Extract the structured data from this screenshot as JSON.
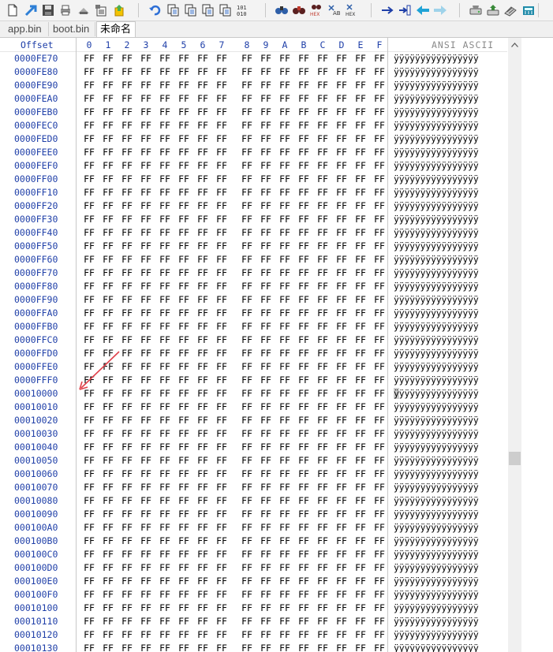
{
  "toolbar": {
    "buttons": [
      {
        "name": "new-file-icon",
        "color": "#3a6fc4"
      },
      {
        "name": "open-file-icon",
        "color": "#2e7fd6"
      },
      {
        "name": "save-icon",
        "color": "#4a4a4a"
      },
      {
        "name": "print-icon",
        "color": "#555555"
      },
      {
        "name": "print-preview-icon",
        "color": "#555555"
      },
      {
        "name": "properties-icon",
        "color": "#555555"
      },
      {
        "name": "export-icon",
        "color": "#d8a200"
      },
      {
        "name": "undo-icon",
        "color": "#2e6fd6"
      },
      {
        "name": "copy-icon",
        "color": "#3a6fc4"
      },
      {
        "name": "copy-block-icon",
        "color": "#3a6fc4"
      },
      {
        "name": "paste-icon",
        "color": "#3a6fc4"
      },
      {
        "name": "paste-write-icon",
        "color": "#3a6fc4"
      },
      {
        "name": "binary-icon",
        "color": "#333333"
      },
      {
        "name": "find-icon",
        "color": "#2e5fa8"
      },
      {
        "name": "find-text-icon",
        "color": "#c0392b"
      },
      {
        "name": "find-hex-icon",
        "color": "#c0392b"
      },
      {
        "name": "replace-text-icon",
        "color": "#2e5fa8"
      },
      {
        "name": "replace-hex-icon",
        "color": "#2e5fa8"
      },
      {
        "name": "goto-offset-icon",
        "color": "#1f3fa8"
      },
      {
        "name": "goto-sector-icon",
        "color": "#1f3fa8"
      },
      {
        "name": "back-icon",
        "color": "#1fa3d6"
      },
      {
        "name": "forward-icon",
        "color": "#9fd3ea"
      },
      {
        "name": "open-disk-icon",
        "color": "#555555"
      },
      {
        "name": "disk-tools-icon",
        "color": "#3a8a3a"
      },
      {
        "name": "ram-editor-icon",
        "color": "#555555"
      },
      {
        "name": "calculator-icon",
        "color": "#1f8aa8"
      }
    ],
    "labels": {
      "hex": "HEX",
      "binary_top": "101",
      "binary_bottom": "010",
      "ab": "AB"
    }
  },
  "tabs": [
    {
      "label": "app.bin",
      "active": false
    },
    {
      "label": "boot.bin",
      "active": false
    },
    {
      "label": "未命名",
      "active": true
    }
  ],
  "header": {
    "offset_label": "Offset",
    "columns": [
      "0",
      "1",
      "2",
      "3",
      "4",
      "5",
      "6",
      "7",
      "8",
      "9",
      "A",
      "B",
      "C",
      "D",
      "E",
      "F"
    ],
    "ascii_label": "ANSI ASCII"
  },
  "rows": [
    {
      "offset": "0000FE70",
      "bytes": [
        "FF",
        "FF",
        "FF",
        "FF",
        "FF",
        "FF",
        "FF",
        "FF",
        "FF",
        "FF",
        "FF",
        "FF",
        "FF",
        "FF",
        "FF",
        "FF"
      ],
      "ascii": "ÿÿÿÿÿÿÿÿÿÿÿÿÿÿÿÿ"
    },
    {
      "offset": "0000FE80",
      "bytes": [
        "FF",
        "FF",
        "FF",
        "FF",
        "FF",
        "FF",
        "FF",
        "FF",
        "FF",
        "FF",
        "FF",
        "FF",
        "FF",
        "FF",
        "FF",
        "FF"
      ],
      "ascii": "ÿÿÿÿÿÿÿÿÿÿÿÿÿÿÿÿ"
    },
    {
      "offset": "0000FE90",
      "bytes": [
        "FF",
        "FF",
        "FF",
        "FF",
        "FF",
        "FF",
        "FF",
        "FF",
        "FF",
        "FF",
        "FF",
        "FF",
        "FF",
        "FF",
        "FF",
        "FF"
      ],
      "ascii": "ÿÿÿÿÿÿÿÿÿÿÿÿÿÿÿÿ"
    },
    {
      "offset": "0000FEA0",
      "bytes": [
        "FF",
        "FF",
        "FF",
        "FF",
        "FF",
        "FF",
        "FF",
        "FF",
        "FF",
        "FF",
        "FF",
        "FF",
        "FF",
        "FF",
        "FF",
        "FF"
      ],
      "ascii": "ÿÿÿÿÿÿÿÿÿÿÿÿÿÿÿÿ"
    },
    {
      "offset": "0000FEB0",
      "bytes": [
        "FF",
        "FF",
        "FF",
        "FF",
        "FF",
        "FF",
        "FF",
        "FF",
        "FF",
        "FF",
        "FF",
        "FF",
        "FF",
        "FF",
        "FF",
        "FF"
      ],
      "ascii": "ÿÿÿÿÿÿÿÿÿÿÿÿÿÿÿÿ"
    },
    {
      "offset": "0000FEC0",
      "bytes": [
        "FF",
        "FF",
        "FF",
        "FF",
        "FF",
        "FF",
        "FF",
        "FF",
        "FF",
        "FF",
        "FF",
        "FF",
        "FF",
        "FF",
        "FF",
        "FF"
      ],
      "ascii": "ÿÿÿÿÿÿÿÿÿÿÿÿÿÿÿÿ"
    },
    {
      "offset": "0000FED0",
      "bytes": [
        "FF",
        "FF",
        "FF",
        "FF",
        "FF",
        "FF",
        "FF",
        "FF",
        "FF",
        "FF",
        "FF",
        "FF",
        "FF",
        "FF",
        "FF",
        "FF"
      ],
      "ascii": "ÿÿÿÿÿÿÿÿÿÿÿÿÿÿÿÿ"
    },
    {
      "offset": "0000FEE0",
      "bytes": [
        "FF",
        "FF",
        "FF",
        "FF",
        "FF",
        "FF",
        "FF",
        "FF",
        "FF",
        "FF",
        "FF",
        "FF",
        "FF",
        "FF",
        "FF",
        "FF"
      ],
      "ascii": "ÿÿÿÿÿÿÿÿÿÿÿÿÿÿÿÿ"
    },
    {
      "offset": "0000FEF0",
      "bytes": [
        "FF",
        "FF",
        "FF",
        "FF",
        "FF",
        "FF",
        "FF",
        "FF",
        "FF",
        "FF",
        "FF",
        "FF",
        "FF",
        "FF",
        "FF",
        "FF"
      ],
      "ascii": "ÿÿÿÿÿÿÿÿÿÿÿÿÿÿÿÿ"
    },
    {
      "offset": "0000FF00",
      "bytes": [
        "FF",
        "FF",
        "FF",
        "FF",
        "FF",
        "FF",
        "FF",
        "FF",
        "FF",
        "FF",
        "FF",
        "FF",
        "FF",
        "FF",
        "FF",
        "FF"
      ],
      "ascii": "ÿÿÿÿÿÿÿÿÿÿÿÿÿÿÿÿ"
    },
    {
      "offset": "0000FF10",
      "bytes": [
        "FF",
        "FF",
        "FF",
        "FF",
        "FF",
        "FF",
        "FF",
        "FF",
        "FF",
        "FF",
        "FF",
        "FF",
        "FF",
        "FF",
        "FF",
        "FF"
      ],
      "ascii": "ÿÿÿÿÿÿÿÿÿÿÿÿÿÿÿÿ"
    },
    {
      "offset": "0000FF20",
      "bytes": [
        "FF",
        "FF",
        "FF",
        "FF",
        "FF",
        "FF",
        "FF",
        "FF",
        "FF",
        "FF",
        "FF",
        "FF",
        "FF",
        "FF",
        "FF",
        "FF"
      ],
      "ascii": "ÿÿÿÿÿÿÿÿÿÿÿÿÿÿÿÿ"
    },
    {
      "offset": "0000FF30",
      "bytes": [
        "FF",
        "FF",
        "FF",
        "FF",
        "FF",
        "FF",
        "FF",
        "FF",
        "FF",
        "FF",
        "FF",
        "FF",
        "FF",
        "FF",
        "FF",
        "FF"
      ],
      "ascii": "ÿÿÿÿÿÿÿÿÿÿÿÿÿÿÿÿ"
    },
    {
      "offset": "0000FF40",
      "bytes": [
        "FF",
        "FF",
        "FF",
        "FF",
        "FF",
        "FF",
        "FF",
        "FF",
        "FF",
        "FF",
        "FF",
        "FF",
        "FF",
        "FF",
        "FF",
        "FF"
      ],
      "ascii": "ÿÿÿÿÿÿÿÿÿÿÿÿÿÿÿÿ"
    },
    {
      "offset": "0000FF50",
      "bytes": [
        "FF",
        "FF",
        "FF",
        "FF",
        "FF",
        "FF",
        "FF",
        "FF",
        "FF",
        "FF",
        "FF",
        "FF",
        "FF",
        "FF",
        "FF",
        "FF"
      ],
      "ascii": "ÿÿÿÿÿÿÿÿÿÿÿÿÿÿÿÿ"
    },
    {
      "offset": "0000FF60",
      "bytes": [
        "FF",
        "FF",
        "FF",
        "FF",
        "FF",
        "FF",
        "FF",
        "FF",
        "FF",
        "FF",
        "FF",
        "FF",
        "FF",
        "FF",
        "FF",
        "FF"
      ],
      "ascii": "ÿÿÿÿÿÿÿÿÿÿÿÿÿÿÿÿ"
    },
    {
      "offset": "0000FF70",
      "bytes": [
        "FF",
        "FF",
        "FF",
        "FF",
        "FF",
        "FF",
        "FF",
        "FF",
        "FF",
        "FF",
        "FF",
        "FF",
        "FF",
        "FF",
        "FF",
        "FF"
      ],
      "ascii": "ÿÿÿÿÿÿÿÿÿÿÿÿÿÿÿÿ"
    },
    {
      "offset": "0000FF80",
      "bytes": [
        "FF",
        "FF",
        "FF",
        "FF",
        "FF",
        "FF",
        "FF",
        "FF",
        "FF",
        "FF",
        "FF",
        "FF",
        "FF",
        "FF",
        "FF",
        "FF"
      ],
      "ascii": "ÿÿÿÿÿÿÿÿÿÿÿÿÿÿÿÿ"
    },
    {
      "offset": "0000FF90",
      "bytes": [
        "FF",
        "FF",
        "FF",
        "FF",
        "FF",
        "FF",
        "FF",
        "FF",
        "FF",
        "FF",
        "FF",
        "FF",
        "FF",
        "FF",
        "FF",
        "FF"
      ],
      "ascii": "ÿÿÿÿÿÿÿÿÿÿÿÿÿÿÿÿ"
    },
    {
      "offset": "0000FFA0",
      "bytes": [
        "FF",
        "FF",
        "FF",
        "FF",
        "FF",
        "FF",
        "FF",
        "FF",
        "FF",
        "FF",
        "FF",
        "FF",
        "FF",
        "FF",
        "FF",
        "FF"
      ],
      "ascii": "ÿÿÿÿÿÿÿÿÿÿÿÿÿÿÿÿ"
    },
    {
      "offset": "0000FFB0",
      "bytes": [
        "FF",
        "FF",
        "FF",
        "FF",
        "FF",
        "FF",
        "FF",
        "FF",
        "FF",
        "FF",
        "FF",
        "FF",
        "FF",
        "FF",
        "FF",
        "FF"
      ],
      "ascii": "ÿÿÿÿÿÿÿÿÿÿÿÿÿÿÿÿ"
    },
    {
      "offset": "0000FFC0",
      "bytes": [
        "FF",
        "FF",
        "FF",
        "FF",
        "FF",
        "FF",
        "FF",
        "FF",
        "FF",
        "FF",
        "FF",
        "FF",
        "FF",
        "FF",
        "FF",
        "FF"
      ],
      "ascii": "ÿÿÿÿÿÿÿÿÿÿÿÿÿÿÿÿ"
    },
    {
      "offset": "0000FFD0",
      "bytes": [
        "FF",
        "FF",
        "FF",
        "FF",
        "FF",
        "FF",
        "FF",
        "FF",
        "FF",
        "FF",
        "FF",
        "FF",
        "FF",
        "FF",
        "FF",
        "FF"
      ],
      "ascii": "ÿÿÿÿÿÿÿÿÿÿÿÿÿÿÿÿ"
    },
    {
      "offset": "0000FFE0",
      "bytes": [
        "FF",
        "FF",
        "FF",
        "FF",
        "FF",
        "FF",
        "FF",
        "FF",
        "FF",
        "FF",
        "FF",
        "FF",
        "FF",
        "FF",
        "FF",
        "FF"
      ],
      "ascii": "ÿÿÿÿÿÿÿÿÿÿÿÿÿÿÿÿ"
    },
    {
      "offset": "0000FFF0",
      "bytes": [
        "FF",
        "FF",
        "FF",
        "FF",
        "FF",
        "FF",
        "FF",
        "FF",
        "FF",
        "FF",
        "FF",
        "FF",
        "FF",
        "FF",
        "FF",
        "FF"
      ],
      "ascii": "ÿÿÿÿÿÿÿÿÿÿÿÿÿÿÿÿ"
    },
    {
      "offset": "00010000",
      "bytes": [
        "FF",
        "FF",
        "FF",
        "FF",
        "FF",
        "FF",
        "FF",
        "FF",
        "FF",
        "FF",
        "FF",
        "FF",
        "FF",
        "FF",
        "FF",
        "FF"
      ],
      "ascii": "ÿÿÿÿÿÿÿÿÿÿÿÿÿÿÿÿ",
      "cursor": true
    },
    {
      "offset": "00010010",
      "bytes": [
        "FF",
        "FF",
        "FF",
        "FF",
        "FF",
        "FF",
        "FF",
        "FF",
        "FF",
        "FF",
        "FF",
        "FF",
        "FF",
        "FF",
        "FF",
        "FF"
      ],
      "ascii": "ÿÿÿÿÿÿÿÿÿÿÿÿÿÿÿÿ"
    },
    {
      "offset": "00010020",
      "bytes": [
        "FF",
        "FF",
        "FF",
        "FF",
        "FF",
        "FF",
        "FF",
        "FF",
        "FF",
        "FF",
        "FF",
        "FF",
        "FF",
        "FF",
        "FF",
        "FF"
      ],
      "ascii": "ÿÿÿÿÿÿÿÿÿÿÿÿÿÿÿÿ"
    },
    {
      "offset": "00010030",
      "bytes": [
        "FF",
        "FF",
        "FF",
        "FF",
        "FF",
        "FF",
        "FF",
        "FF",
        "FF",
        "FF",
        "FF",
        "FF",
        "FF",
        "FF",
        "FF",
        "FF"
      ],
      "ascii": "ÿÿÿÿÿÿÿÿÿÿÿÿÿÿÿÿ"
    },
    {
      "offset": "00010040",
      "bytes": [
        "FF",
        "FF",
        "FF",
        "FF",
        "FF",
        "FF",
        "FF",
        "FF",
        "FF",
        "FF",
        "FF",
        "FF",
        "FF",
        "FF",
        "FF",
        "FF"
      ],
      "ascii": "ÿÿÿÿÿÿÿÿÿÿÿÿÿÿÿÿ"
    },
    {
      "offset": "00010050",
      "bytes": [
        "FF",
        "FF",
        "FF",
        "FF",
        "FF",
        "FF",
        "FF",
        "FF",
        "FF",
        "FF",
        "FF",
        "FF",
        "FF",
        "FF",
        "FF",
        "FF"
      ],
      "ascii": "ÿÿÿÿÿÿÿÿÿÿÿÿÿÿÿÿ"
    },
    {
      "offset": "00010060",
      "bytes": [
        "FF",
        "FF",
        "FF",
        "FF",
        "FF",
        "FF",
        "FF",
        "FF",
        "FF",
        "FF",
        "FF",
        "FF",
        "FF",
        "FF",
        "FF",
        "FF"
      ],
      "ascii": "ÿÿÿÿÿÿÿÿÿÿÿÿÿÿÿÿ"
    },
    {
      "offset": "00010070",
      "bytes": [
        "FF",
        "FF",
        "FF",
        "FF",
        "FF",
        "FF",
        "FF",
        "FF",
        "FF",
        "FF",
        "FF",
        "FF",
        "FF",
        "FF",
        "FF",
        "FF"
      ],
      "ascii": "ÿÿÿÿÿÿÿÿÿÿÿÿÿÿÿÿ"
    },
    {
      "offset": "00010080",
      "bytes": [
        "FF",
        "FF",
        "FF",
        "FF",
        "FF",
        "FF",
        "FF",
        "FF",
        "FF",
        "FF",
        "FF",
        "FF",
        "FF",
        "FF",
        "FF",
        "FF"
      ],
      "ascii": "ÿÿÿÿÿÿÿÿÿÿÿÿÿÿÿÿ"
    },
    {
      "offset": "00010090",
      "bytes": [
        "FF",
        "FF",
        "FF",
        "FF",
        "FF",
        "FF",
        "FF",
        "FF",
        "FF",
        "FF",
        "FF",
        "FF",
        "FF",
        "FF",
        "FF",
        "FF"
      ],
      "ascii": "ÿÿÿÿÿÿÿÿÿÿÿÿÿÿÿÿ"
    },
    {
      "offset": "000100A0",
      "bytes": [
        "FF",
        "FF",
        "FF",
        "FF",
        "FF",
        "FF",
        "FF",
        "FF",
        "FF",
        "FF",
        "FF",
        "FF",
        "FF",
        "FF",
        "FF",
        "FF"
      ],
      "ascii": "ÿÿÿÿÿÿÿÿÿÿÿÿÿÿÿÿ"
    },
    {
      "offset": "000100B0",
      "bytes": [
        "FF",
        "FF",
        "FF",
        "FF",
        "FF",
        "FF",
        "FF",
        "FF",
        "FF",
        "FF",
        "FF",
        "FF",
        "FF",
        "FF",
        "FF",
        "FF"
      ],
      "ascii": "ÿÿÿÿÿÿÿÿÿÿÿÿÿÿÿÿ"
    },
    {
      "offset": "000100C0",
      "bytes": [
        "FF",
        "FF",
        "FF",
        "FF",
        "FF",
        "FF",
        "FF",
        "FF",
        "FF",
        "FF",
        "FF",
        "FF",
        "FF",
        "FF",
        "FF",
        "FF"
      ],
      "ascii": "ÿÿÿÿÿÿÿÿÿÿÿÿÿÿÿÿ"
    },
    {
      "offset": "000100D0",
      "bytes": [
        "FF",
        "FF",
        "FF",
        "FF",
        "FF",
        "FF",
        "FF",
        "FF",
        "FF",
        "FF",
        "FF",
        "FF",
        "FF",
        "FF",
        "FF",
        "FF"
      ],
      "ascii": "ÿÿÿÿÿÿÿÿÿÿÿÿÿÿÿÿ"
    },
    {
      "offset": "000100E0",
      "bytes": [
        "FF",
        "FF",
        "FF",
        "FF",
        "FF",
        "FF",
        "FF",
        "FF",
        "FF",
        "FF",
        "FF",
        "FF",
        "FF",
        "FF",
        "FF",
        "FF"
      ],
      "ascii": "ÿÿÿÿÿÿÿÿÿÿÿÿÿÿÿÿ"
    },
    {
      "offset": "000100F0",
      "bytes": [
        "FF",
        "FF",
        "FF",
        "FF",
        "FF",
        "FF",
        "FF",
        "FF",
        "FF",
        "FF",
        "FF",
        "FF",
        "FF",
        "FF",
        "FF",
        "FF"
      ],
      "ascii": "ÿÿÿÿÿÿÿÿÿÿÿÿÿÿÿÿ"
    },
    {
      "offset": "00010100",
      "bytes": [
        "FF",
        "FF",
        "FF",
        "FF",
        "FF",
        "FF",
        "FF",
        "FF",
        "FF",
        "FF",
        "FF",
        "FF",
        "FF",
        "FF",
        "FF",
        "FF"
      ],
      "ascii": "ÿÿÿÿÿÿÿÿÿÿÿÿÿÿÿÿ"
    },
    {
      "offset": "00010110",
      "bytes": [
        "FF",
        "FF",
        "FF",
        "FF",
        "FF",
        "FF",
        "FF",
        "FF",
        "FF",
        "FF",
        "FF",
        "FF",
        "FF",
        "FF",
        "FF",
        "FF"
      ],
      "ascii": "ÿÿÿÿÿÿÿÿÿÿÿÿÿÿÿÿ"
    },
    {
      "offset": "00010120",
      "bytes": [
        "FF",
        "FF",
        "FF",
        "FF",
        "FF",
        "FF",
        "FF",
        "FF",
        "FF",
        "FF",
        "FF",
        "FF",
        "FF",
        "FF",
        "FF",
        "FF"
      ],
      "ascii": "ÿÿÿÿÿÿÿÿÿÿÿÿÿÿÿÿ"
    },
    {
      "offset": "00010130",
      "bytes": [
        "FF",
        "FF",
        "FF",
        "FF",
        "FF",
        "FF",
        "FF",
        "FF",
        "FF",
        "FF",
        "FF",
        "FF",
        "FF",
        "FF",
        "FF",
        "FF"
      ],
      "ascii": "ÿÿÿÿÿÿÿÿÿÿÿÿÿÿÿÿ"
    }
  ],
  "annotation": {
    "name": "red-arrow-annotation",
    "color": "#e0404a"
  },
  "colors": {
    "offset_text": "#1f3fa8",
    "hex_text": "#000000",
    "ascii_header": "#8a8a8a"
  }
}
